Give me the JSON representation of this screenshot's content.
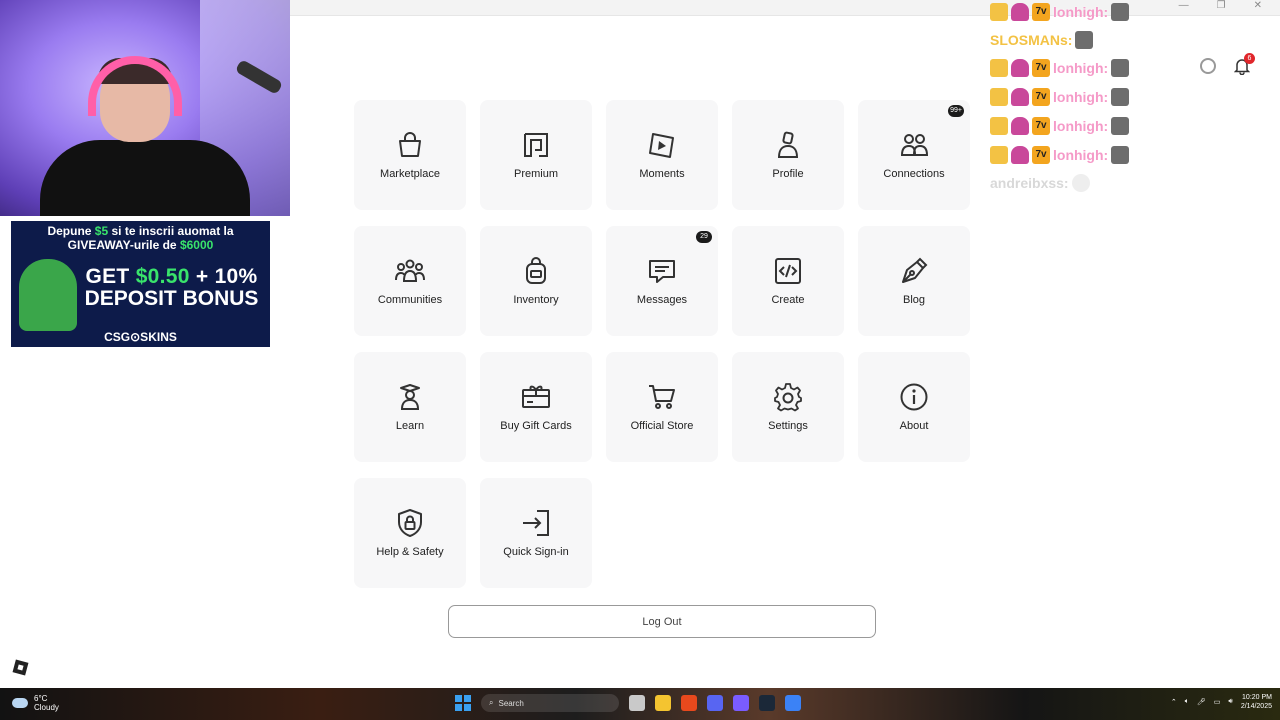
{
  "tiles": [
    {
      "label": "Marketplace",
      "icon": "shopping-bag-icon"
    },
    {
      "label": "Premium",
      "icon": "premium-icon"
    },
    {
      "label": "Moments",
      "icon": "moments-play-icon"
    },
    {
      "label": "Profile",
      "icon": "profile-person-icon"
    },
    {
      "label": "Connections",
      "icon": "connections-people-icon",
      "badge": "99+"
    },
    {
      "label": "Communities",
      "icon": "communities-group-icon"
    },
    {
      "label": "Inventory",
      "icon": "backpack-icon"
    },
    {
      "label": "Messages",
      "icon": "message-icon",
      "badge": "29"
    },
    {
      "label": "Create",
      "icon": "code-icon"
    },
    {
      "label": "Blog",
      "icon": "pen-nib-icon"
    },
    {
      "label": "Learn",
      "icon": "graduate-icon"
    },
    {
      "label": "Buy Gift Cards",
      "icon": "gift-card-icon"
    },
    {
      "label": "Official Store",
      "icon": "cart-icon"
    },
    {
      "label": "Settings",
      "icon": "gear-icon"
    },
    {
      "label": "About",
      "icon": "info-icon"
    },
    {
      "label": "Help & Safety",
      "icon": "shield-lock-icon"
    },
    {
      "label": "Quick Sign-in",
      "icon": "sign-in-icon"
    }
  ],
  "logout_label": "Log Out",
  "notification_count": "6",
  "chat": {
    "user_main": "lonhigh:",
    "user_gold": "SLOSMANs:",
    "user_faded": "andreibxss:",
    "badge_seven": "7v"
  },
  "ad": {
    "line1_a": "Depune ",
    "line1_g": "$5",
    "line1_b": " si te inscrii auomat la",
    "line2_a": "GIVEAWAY-urile de ",
    "line2_g": "$6000",
    "big1_a": "GET ",
    "big1_g": "$0.50",
    "big1_b": " + 10%",
    "big2": "DEPOSIT BONUS",
    "brand": "CSG⊙SKINS"
  },
  "taskbar": {
    "temp": "6°C",
    "weather": "Cloudy",
    "search_placeholder": "Search",
    "time": "10:20 PM",
    "date": "2/14/2025"
  },
  "colors": {
    "tile_bg": "#f7f7f8",
    "badge_bg": "#1b1b1b",
    "notify_red": "#e0262b"
  }
}
